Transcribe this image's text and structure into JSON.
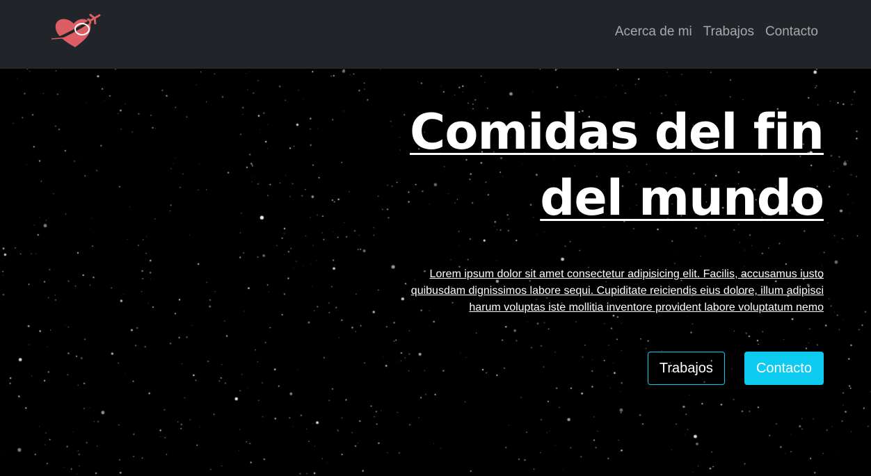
{
  "navbar": {
    "logo_icon": "heart-with-airplane-icon",
    "links": [
      "Acerca de mi",
      "Trabajos",
      "Contacto"
    ]
  },
  "hero": {
    "title": "Comidas del fin del mundo",
    "text": "Lorem ipsum dolor sit amet consectetur adipisicing elit. Facilis, accusamus iusto quibusdam dignissimos labore sequi. Cupiditate reiciendis eius dolore, illum adipisci harum voluptas iste mollitia inventore provident labore voluptatum nemo",
    "buttons": {
      "primary_outline": "Trabajos",
      "primary_filled": "Contacto"
    }
  },
  "colors": {
    "navbar_bg": "#212529",
    "accent": "#0dcaf0",
    "logo": "#dc5d64",
    "background": "#000000"
  }
}
